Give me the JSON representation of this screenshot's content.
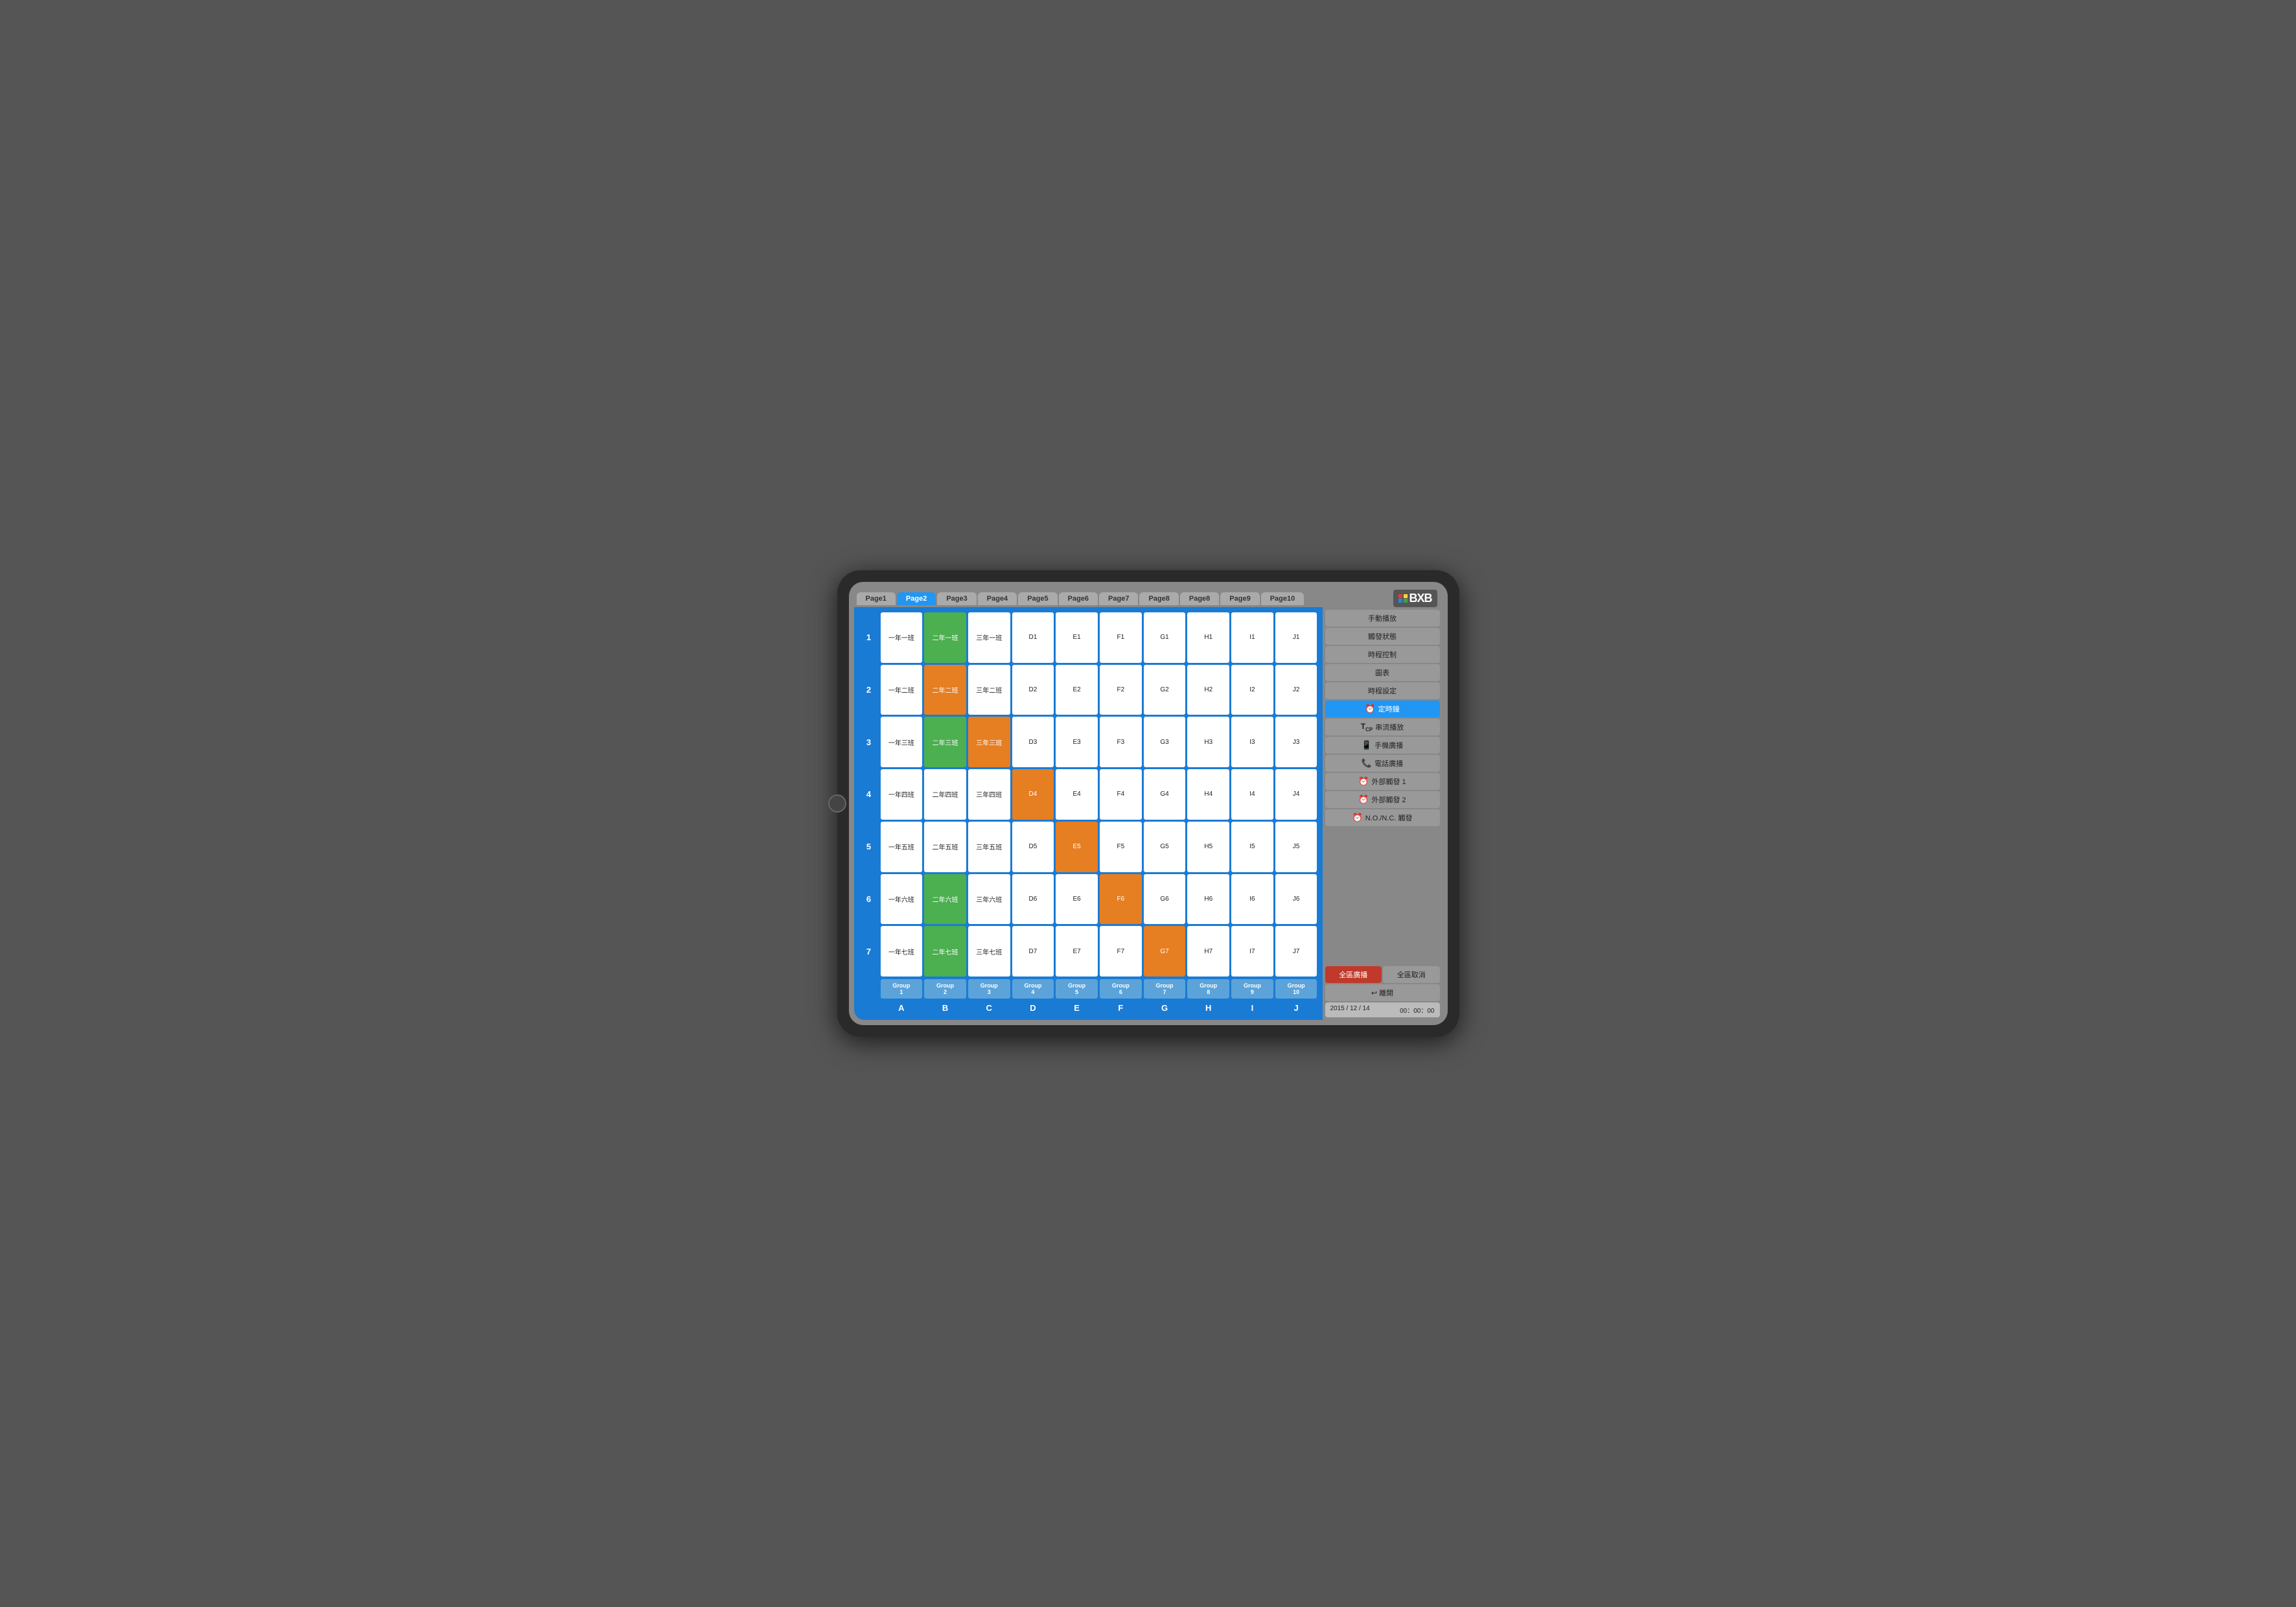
{
  "tabs": [
    {
      "label": "Page1",
      "active": false
    },
    {
      "label": "Page2",
      "active": true
    },
    {
      "label": "Page3",
      "active": false
    },
    {
      "label": "Page4",
      "active": false
    },
    {
      "label": "Page5",
      "active": false
    },
    {
      "label": "Page6",
      "active": false
    },
    {
      "label": "Page7",
      "active": false
    },
    {
      "label": "Page8",
      "active": false
    },
    {
      "label": "Page8",
      "active": false
    },
    {
      "label": "Page9",
      "active": false
    },
    {
      "label": "Page10",
      "active": false
    }
  ],
  "rows": [
    {
      "num": "1",
      "cells": [
        {
          "text": "一年一班",
          "color": "white"
        },
        {
          "text": "二年一班",
          "color": "green"
        },
        {
          "text": "三年一班",
          "color": "white"
        },
        {
          "text": "D1",
          "color": "white"
        },
        {
          "text": "E1",
          "color": "white"
        },
        {
          "text": "F1",
          "color": "white"
        },
        {
          "text": "G1",
          "color": "white"
        },
        {
          "text": "H1",
          "color": "white"
        },
        {
          "text": "I1",
          "color": "white"
        },
        {
          "text": "J1",
          "color": "white"
        }
      ]
    },
    {
      "num": "2",
      "cells": [
        {
          "text": "一年二班",
          "color": "white"
        },
        {
          "text": "二年二班",
          "color": "orange"
        },
        {
          "text": "三年二班",
          "color": "white"
        },
        {
          "text": "D2",
          "color": "white"
        },
        {
          "text": "E2",
          "color": "white"
        },
        {
          "text": "F2",
          "color": "white"
        },
        {
          "text": "G2",
          "color": "white"
        },
        {
          "text": "H2",
          "color": "white"
        },
        {
          "text": "I2",
          "color": "white"
        },
        {
          "text": "J2",
          "color": "white"
        }
      ]
    },
    {
      "num": "3",
      "cells": [
        {
          "text": "一年三班",
          "color": "white"
        },
        {
          "text": "二年三班",
          "color": "green"
        },
        {
          "text": "三年三班",
          "color": "orange"
        },
        {
          "text": "D3",
          "color": "white"
        },
        {
          "text": "E3",
          "color": "white"
        },
        {
          "text": "F3",
          "color": "white"
        },
        {
          "text": "G3",
          "color": "white"
        },
        {
          "text": "H3",
          "color": "white"
        },
        {
          "text": "I3",
          "color": "white"
        },
        {
          "text": "J3",
          "color": "white"
        }
      ]
    },
    {
      "num": "4",
      "cells": [
        {
          "text": "一年四班",
          "color": "white"
        },
        {
          "text": "二年四班",
          "color": "white"
        },
        {
          "text": "三年四班",
          "color": "white"
        },
        {
          "text": "D4",
          "color": "orange"
        },
        {
          "text": "E4",
          "color": "white"
        },
        {
          "text": "F4",
          "color": "white"
        },
        {
          "text": "G4",
          "color": "white"
        },
        {
          "text": "H4",
          "color": "white"
        },
        {
          "text": "I4",
          "color": "white"
        },
        {
          "text": "J4",
          "color": "white"
        }
      ]
    },
    {
      "num": "5",
      "cells": [
        {
          "text": "一年五班",
          "color": "white"
        },
        {
          "text": "二年五班",
          "color": "white"
        },
        {
          "text": "三年五班",
          "color": "white"
        },
        {
          "text": "D5",
          "color": "white"
        },
        {
          "text": "E5",
          "color": "orange"
        },
        {
          "text": "F5",
          "color": "white"
        },
        {
          "text": "G5",
          "color": "white"
        },
        {
          "text": "H5",
          "color": "white"
        },
        {
          "text": "I5",
          "color": "white"
        },
        {
          "text": "J5",
          "color": "white"
        }
      ]
    },
    {
      "num": "6",
      "cells": [
        {
          "text": "一年六班",
          "color": "white"
        },
        {
          "text": "二年六班",
          "color": "green"
        },
        {
          "text": "三年六班",
          "color": "white"
        },
        {
          "text": "D6",
          "color": "white"
        },
        {
          "text": "E6",
          "color": "white"
        },
        {
          "text": "F6",
          "color": "orange"
        },
        {
          "text": "G6",
          "color": "white"
        },
        {
          "text": "H6",
          "color": "white"
        },
        {
          "text": "I6",
          "color": "white"
        },
        {
          "text": "J6",
          "color": "white"
        }
      ]
    },
    {
      "num": "7",
      "cells": [
        {
          "text": "一年七班",
          "color": "white"
        },
        {
          "text": "二年七班",
          "color": "green"
        },
        {
          "text": "三年七班",
          "color": "white"
        },
        {
          "text": "D7",
          "color": "white"
        },
        {
          "text": "E7",
          "color": "white"
        },
        {
          "text": "F7",
          "color": "white"
        },
        {
          "text": "G7",
          "color": "orange"
        },
        {
          "text": "H7",
          "color": "white"
        },
        {
          "text": "I7",
          "color": "white"
        },
        {
          "text": "J7",
          "color": "white"
        }
      ]
    }
  ],
  "groups": [
    {
      "label": "Group\n1"
    },
    {
      "label": "Group\n2"
    },
    {
      "label": "Group\n3"
    },
    {
      "label": "Group\n4"
    },
    {
      "label": "Group\n5"
    },
    {
      "label": "Group\n6"
    },
    {
      "label": "Group\n7"
    },
    {
      "label": "Group\n8"
    },
    {
      "label": "Group\n9"
    },
    {
      "label": "Group\n10"
    }
  ],
  "col_labels": [
    "A",
    "B",
    "C",
    "D",
    "E",
    "F",
    "G",
    "H",
    "I",
    "J"
  ],
  "sidebar": {
    "buttons": [
      {
        "label": "手動播放",
        "icon": "",
        "active": false
      },
      {
        "label": "觸發狀態",
        "icon": "",
        "active": false
      },
      {
        "label": "時程控制",
        "icon": "",
        "active": false
      },
      {
        "label": "圖表",
        "icon": "",
        "active": false
      },
      {
        "label": "時程設定",
        "icon": "",
        "active": false
      },
      {
        "label": "定時鐘",
        "icon": "⏰",
        "active": true
      },
      {
        "label": "串流播放",
        "icon": "T",
        "active": false
      },
      {
        "label": "手機廣播",
        "icon": "📱",
        "active": false
      },
      {
        "label": "電話廣播",
        "icon": "📞",
        "active": false
      },
      {
        "label": "外部觸發 1",
        "icon": "⏰",
        "active": false
      },
      {
        "label": "外部觸發 2",
        "icon": "⏰",
        "active": false
      },
      {
        "label": "N.O./N.C. 觸發",
        "icon": "⏰",
        "active": false
      }
    ],
    "broadcast_label": "全區廣播",
    "cancel_label": "全區取消",
    "exit_label": "離開",
    "date": "2015 / 12 / 14",
    "time": "00：00：00"
  }
}
